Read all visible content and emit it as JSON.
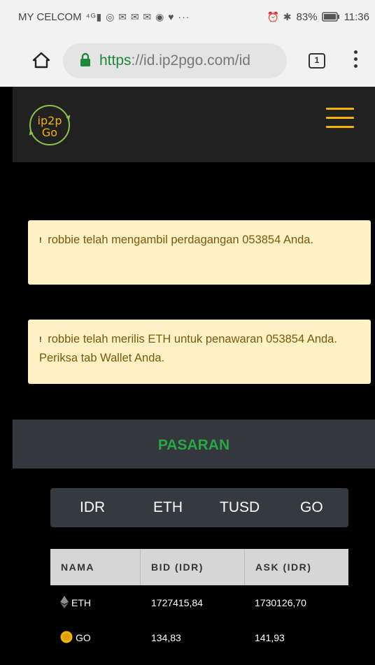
{
  "statusbar": {
    "carrier": "MY CELCOM",
    "icons": "⁴ᴳ▮ ◎ ✉ ✉ ✉ ◉ ♥ ···",
    "alarm_bt": "⏰ ✱",
    "battery": "83%",
    "time": "11:36"
  },
  "browser": {
    "url_scheme": "https",
    "url_rest": "://id.ip2pgo.com/id",
    "tab_count": "1"
  },
  "header": {
    "logo_text_top": "ip2p",
    "logo_text_bottom": "Go"
  },
  "alerts": [
    {
      "icon": "!",
      "text": "robbie telah mengambil perdagangan 053854 Anda."
    },
    {
      "icon": "!",
      "text": "robbie telah merilis ETH untuk penawaran 053854 Anda. Periksa tab Wallet Anda."
    }
  ],
  "market": {
    "title": "PASARAN",
    "tabs": [
      "IDR",
      "ETH",
      "TUSD",
      "GO"
    ],
    "columns": [
      "NAMA",
      "BID (IDR)",
      "ASK (IDR)"
    ],
    "rows": [
      {
        "name": "ETH",
        "bid": "1727415,84",
        "ask": "1730126,70",
        "icon": "eth-icon"
      },
      {
        "name": "GO",
        "bid": "134,83",
        "ask": "141,93",
        "icon": "go-coin-icon"
      }
    ]
  },
  "colors": {
    "accent_green": "#29a745",
    "hamburger_yellow": "#f4b400",
    "alert_bg": "#fef1c4",
    "alert_text": "#7a5a10",
    "header_bg": "#212121"
  }
}
